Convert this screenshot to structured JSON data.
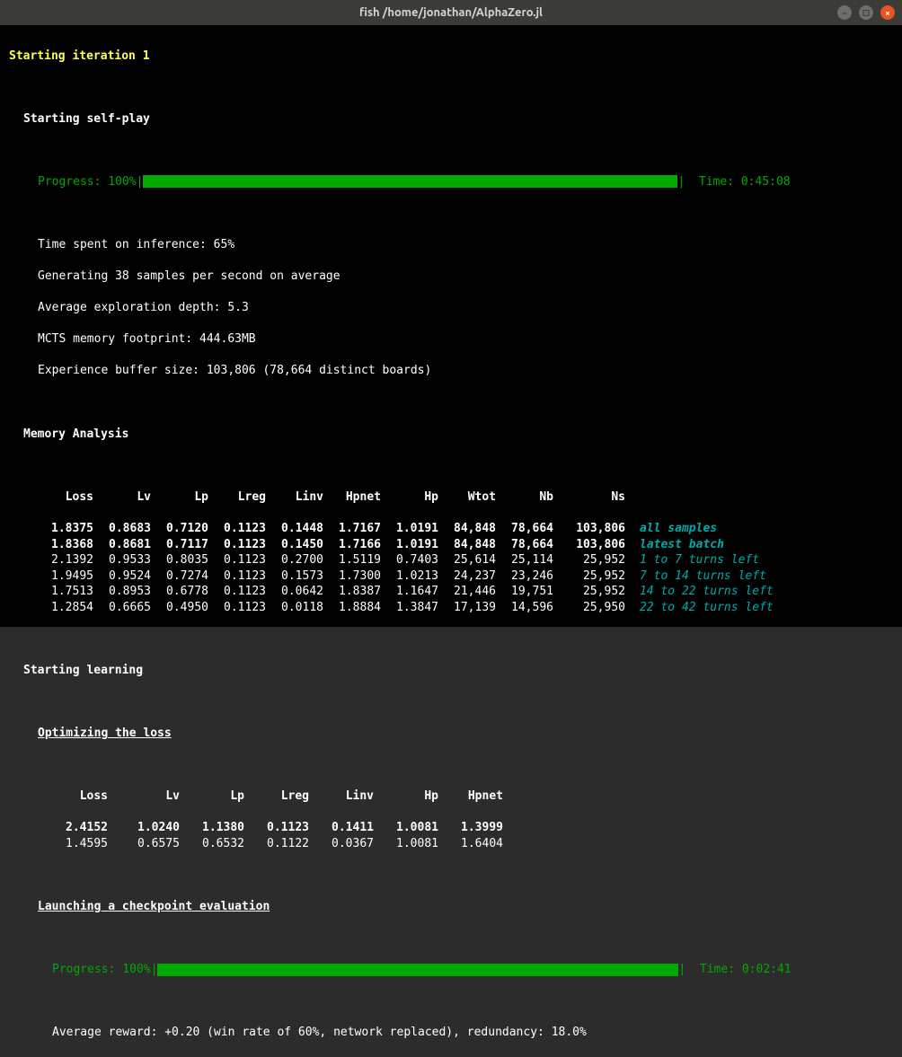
{
  "window": {
    "title": "fish  /home/jonathan/AlphaZero.jl"
  },
  "iteration_header": "Starting iteration 1",
  "selfplay": {
    "header": "Starting self-play",
    "progress_label": "Progress: 100%",
    "time_label": "Time: 0:45:08",
    "inference_line": "Time spent on inference: 65%",
    "samples_line": "Generating 38 samples per second on average",
    "depth_line": "Average exploration depth: 5.3",
    "mcts_line": "MCTS memory footprint: 444.63MB",
    "buffer_line": "Experience buffer size: 103,806 (78,664 distinct boards)"
  },
  "memory": {
    "header": "Memory Analysis",
    "columns": [
      "Loss",
      "Lv",
      "Lp",
      "Lreg",
      "Linv",
      "Hpnet",
      "Hp",
      "Wtot",
      "Nb",
      "Ns"
    ],
    "rows": [
      {
        "v": [
          "1.8375",
          "0.8683",
          "0.7120",
          "0.1123",
          "0.1448",
          "1.7167",
          "1.0191",
          "84,848",
          "78,664",
          "103,806"
        ],
        "note": "all samples",
        "bold": true
      },
      {
        "v": [
          "1.8368",
          "0.8681",
          "0.7117",
          "0.1123",
          "0.1450",
          "1.7166",
          "1.0191",
          "84,848",
          "78,664",
          "103,806"
        ],
        "note": "latest batch",
        "bold": true
      },
      {
        "v": [
          "2.1392",
          "0.9533",
          "0.8035",
          "0.1123",
          "0.2700",
          "1.5119",
          "0.7403",
          "25,614",
          "25,114",
          "25,952"
        ],
        "note": "1 to 7 turns left",
        "bold": false
      },
      {
        "v": [
          "1.9495",
          "0.9524",
          "0.7274",
          "0.1123",
          "0.1573",
          "1.7300",
          "1.0213",
          "24,237",
          "23,246",
          "25,952"
        ],
        "note": "7 to 14 turns left",
        "bold": false
      },
      {
        "v": [
          "1.7513",
          "0.8953",
          "0.6778",
          "0.1123",
          "0.0642",
          "1.8387",
          "1.1647",
          "21,446",
          "19,751",
          "25,952"
        ],
        "note": "14 to 22 turns left",
        "bold": false
      },
      {
        "v": [
          "1.2854",
          "0.6665",
          "0.4950",
          "0.1123",
          "0.0118",
          "1.8884",
          "1.3847",
          "17,139",
          "14,596",
          "25,950"
        ],
        "note": "22 to 42 turns left",
        "bold": false
      }
    ]
  },
  "learning": {
    "header": "Starting learning",
    "optimize_header": "Optimizing the loss",
    "columns": [
      "Loss",
      "Lv",
      "Lp",
      "Lreg",
      "Linv",
      "Hp",
      "Hpnet"
    ],
    "rows": [
      {
        "v": [
          "2.4152",
          "1.0240",
          "1.1380",
          "0.1123",
          "0.1411",
          "1.0081",
          "1.3999"
        ],
        "bold": true
      },
      {
        "v": [
          "1.4595",
          "0.6575",
          "0.6532",
          "0.1122",
          "0.0367",
          "1.0081",
          "1.6404"
        ],
        "bold": false
      }
    ],
    "checkpoint_header": "Launching a checkpoint evaluation",
    "progress_label": "Progress: 100%",
    "time_label": "Time: 0:02:41",
    "reward_line": "Average reward: +0.20 (win rate of 60%, network replaced), redundancy: 18.0%"
  }
}
